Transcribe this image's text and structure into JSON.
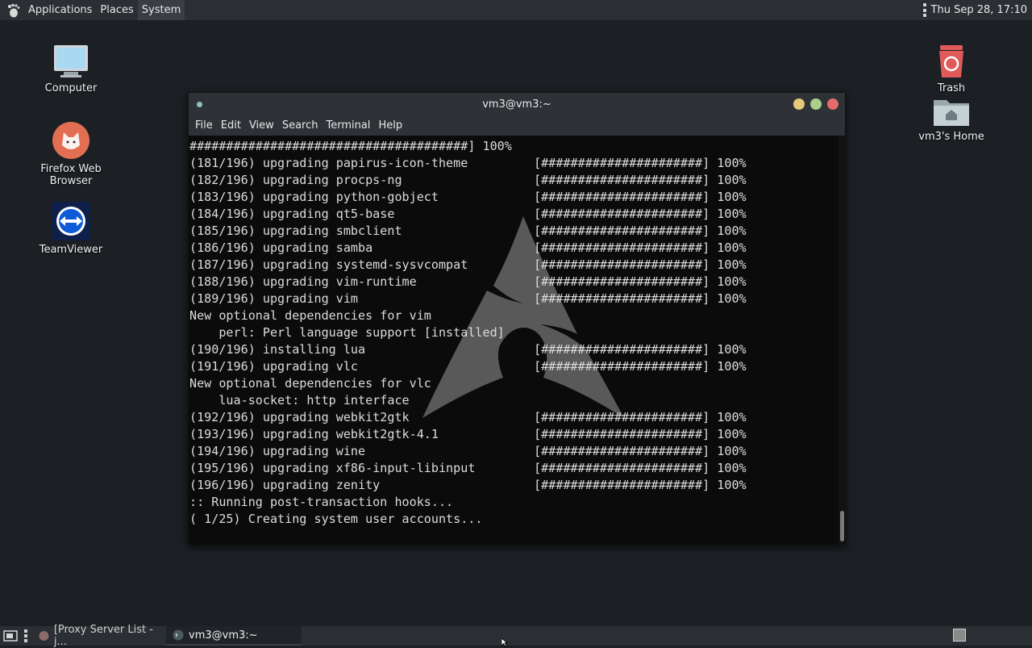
{
  "top_panel": {
    "menu": [
      "Applications",
      "Places",
      "System"
    ],
    "clock": "Thu Sep 28, 17:10"
  },
  "desktop": {
    "computer": "Computer",
    "firefox": "Firefox Web Browser",
    "teamviewer": "TeamViewer",
    "trash": "Trash",
    "home": "vm3's Home"
  },
  "terminal": {
    "title": "vm3@vm3:~",
    "menu": [
      "File",
      "Edit",
      "View",
      "Search",
      "Terminal",
      "Help"
    ],
    "lines": [
      "######################################] 100%",
      "(181/196) upgrading papirus-icon-theme         [######################] 100%",
      "(182/196) upgrading procps-ng                  [######################] 100%",
      "(183/196) upgrading python-gobject             [######################] 100%",
      "(184/196) upgrading qt5-base                   [######################] 100%",
      "(185/196) upgrading smbclient                  [######################] 100%",
      "(186/196) upgrading samba                      [######################] 100%",
      "(187/196) upgrading systemd-sysvcompat         [######################] 100%",
      "(188/196) upgrading vim-runtime                [######################] 100%",
      "(189/196) upgrading vim                        [######################] 100%",
      "New optional dependencies for vim",
      "    perl: Perl language support [installed]",
      "(190/196) installing lua                       [######################] 100%",
      "(191/196) upgrading vlc                        [######################] 100%",
      "New optional dependencies for vlc",
      "    lua-socket: http interface",
      "(192/196) upgrading webkit2gtk                 [######################] 100%",
      "(193/196) upgrading webkit2gtk-4.1             [######################] 100%",
      "(194/196) upgrading wine                       [######################] 100%",
      "(195/196) upgrading xf86-input-libinput        [######################] 100%",
      "(196/196) upgrading zenity                     [######################] 100%",
      ":: Running post-transaction hooks...",
      "( 1/25) Creating system user accounts..."
    ]
  },
  "taskbar": {
    "task1": "[Proxy Server List - j...",
    "task2": "vm3@vm3:~"
  }
}
